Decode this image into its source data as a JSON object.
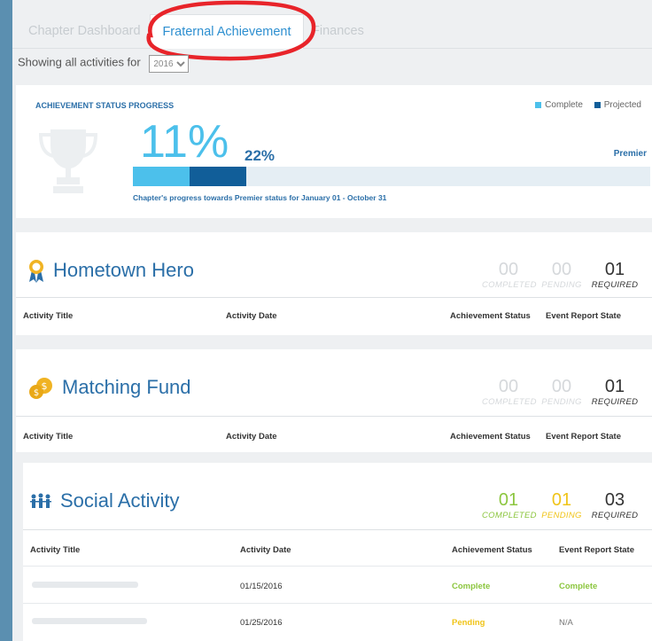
{
  "tabs": [
    {
      "label": "Chapter Dashboard",
      "active": false
    },
    {
      "label": "Fraternal Achievement",
      "active": true
    },
    {
      "label": "Finances",
      "active": false
    }
  ],
  "filter": {
    "label": "Showing all activities for",
    "year": "2016"
  },
  "achievement": {
    "title": "ACHIEVEMENT STATUS PROGRESS",
    "legend": [
      {
        "label": "Complete",
        "color": "#4cc0eb"
      },
      {
        "label": "Projected",
        "color": "#115e99"
      }
    ],
    "complete_percent": "11%",
    "projected_percent": "22%",
    "complete_value": 11,
    "projected_value": 22,
    "target_label": "Premier",
    "caption": "Chapter's progress towards Premier status for January 01 - October 31"
  },
  "count_labels": {
    "completed": "COMPLETED",
    "pending": "PENDING",
    "required": "REQUIRED"
  },
  "table_headers": {
    "title": "Activity Title",
    "date": "Activity Date",
    "status": "Achievement Status",
    "report": "Event Report State"
  },
  "sections": [
    {
      "name": "Hometown Hero",
      "icon": "ribbon-icon",
      "completed": "00",
      "pending": "00",
      "required": "01"
    },
    {
      "name": "Matching Fund",
      "icon": "coins-icon",
      "completed": "00",
      "pending": "00",
      "required": "01"
    },
    {
      "name": "Social Activity",
      "icon": "people-icon",
      "completed": "01",
      "pending": "01",
      "required": "03",
      "rows": [
        {
          "date": "01/15/2016",
          "status": "Complete",
          "report": "Complete"
        },
        {
          "date": "01/25/2016",
          "status": "Pending",
          "report": "N/A"
        }
      ]
    }
  ],
  "colors": {
    "accent": "#2b6fa8",
    "complete": "#8cc63f",
    "pending": "#f0c419"
  }
}
